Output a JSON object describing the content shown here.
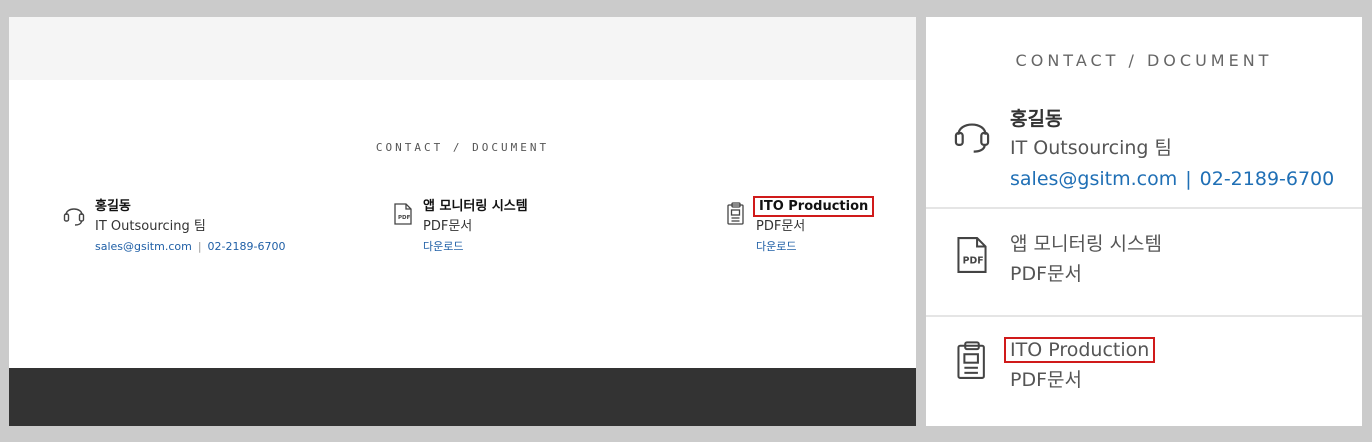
{
  "contact_section": {
    "heading": "CONTACT / DOCUMENT",
    "contact": {
      "name": "홍길동",
      "team": "IT Outsourcing 팀",
      "email": "sales@gsitm.com",
      "separator": "|",
      "phone": "02-2189-6700"
    },
    "documents": [
      {
        "title": "앱 모니터링 시스템",
        "type": "PDF문서",
        "download": "다운로드",
        "icon": "pdf-file-icon"
      },
      {
        "title": "ITO Production",
        "type": "PDF문서",
        "download": "다운로드",
        "icon": "document-icon"
      }
    ]
  },
  "icons": {
    "contact": "headset-icon",
    "pdf": "pdf-file-icon",
    "doc": "document-icon"
  },
  "colors": {
    "link": "#1f5fa6",
    "highlight": "#d01a1a",
    "footer": "#333333"
  }
}
